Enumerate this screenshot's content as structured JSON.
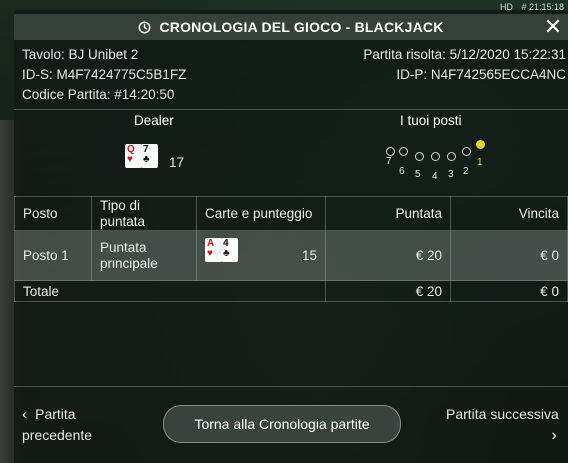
{
  "status_bar": {
    "quality": "HD",
    "time": "# 21:15:18"
  },
  "header": {
    "title": "CRONOLOGIA DEL GIOCO - BLACKJACK"
  },
  "info": {
    "table": "Tavolo: BJ Unibet 2",
    "resolved": "Partita risolta: 5/12/2020 15:22:31",
    "ids": "ID-S: M4F7424775C5B1FZ",
    "idp": "ID-P: N4F742565ECCA4NC",
    "game_code": "Codice Partita: #14:20:50"
  },
  "dealer": {
    "label": "Dealer",
    "cards": [
      {
        "rank": "Q",
        "suit": "♥",
        "red": true
      },
      {
        "rank": "7",
        "suit": "♣",
        "red": false
      }
    ],
    "total": "17"
  },
  "seats": {
    "label": "I tuoi posti",
    "numbers": [
      "7",
      "6",
      "5",
      "4",
      "3",
      "2",
      "1"
    ],
    "active": "1"
  },
  "table": {
    "headers": {
      "seat": "Posto",
      "bet_type": "Tipo di puntata",
      "cards": "Carte e punteggio",
      "bet": "Puntata",
      "win": "Vincita"
    },
    "rows": [
      {
        "seat": "Posto 1",
        "bet_type": "Puntata principale",
        "cards": [
          {
            "rank": "A",
            "suit": "♥",
            "red": true
          },
          {
            "rank": "4",
            "suit": "♣",
            "red": false
          }
        ],
        "score": "15",
        "bet": "€ 20",
        "win": "€ 0"
      }
    ],
    "total": {
      "label": "Totale",
      "bet": "€ 20",
      "win": "€ 0"
    }
  },
  "nav": {
    "prev": "Partita precedente",
    "back": "Torna alla Cronologia partite",
    "next": "Partita successiva"
  },
  "colors": {
    "accent": "#f1d21a",
    "overlay": "#121a16"
  }
}
